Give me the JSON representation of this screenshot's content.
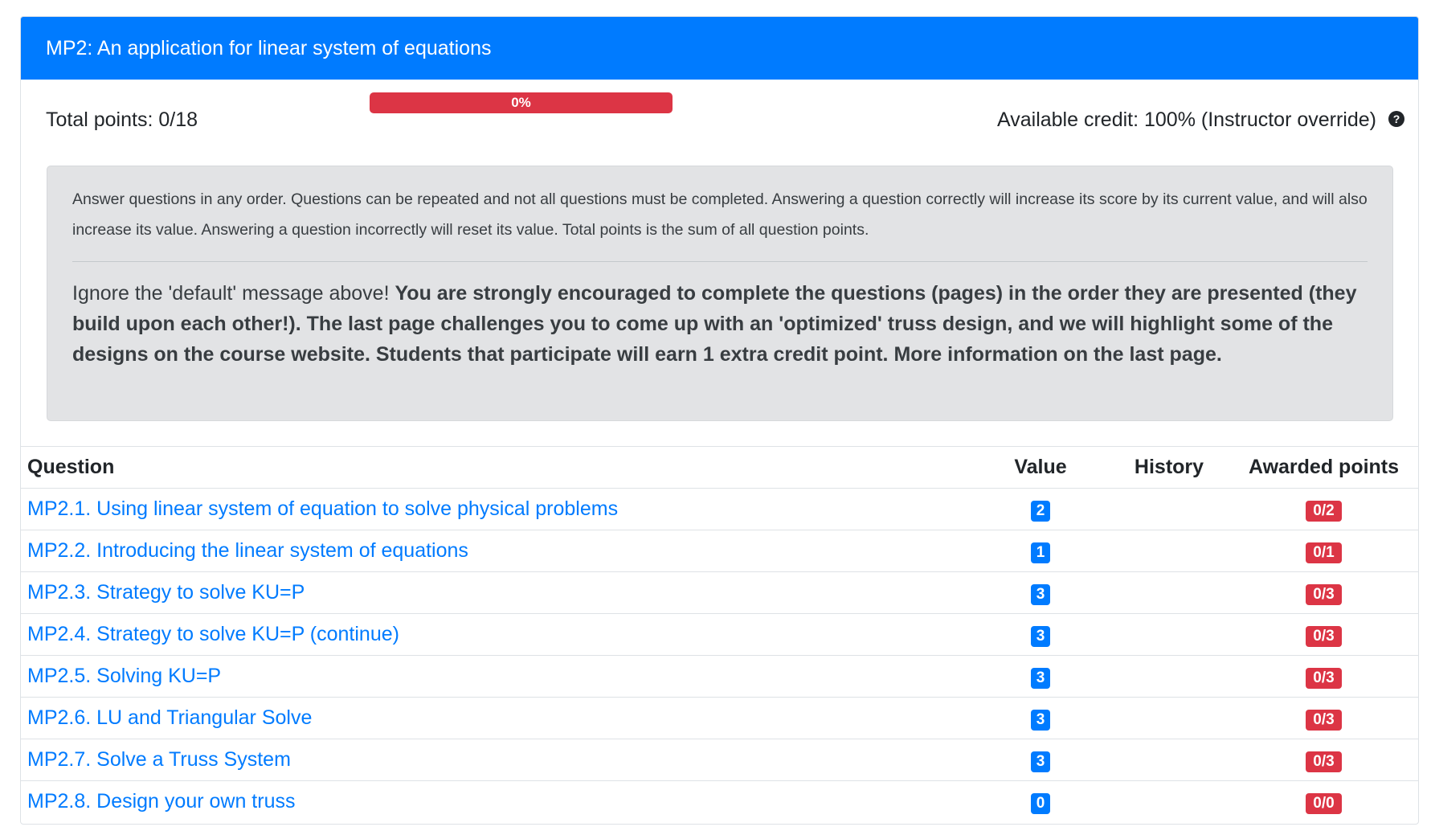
{
  "header": {
    "title": "MP2: An application for linear system of equations"
  },
  "points": {
    "total_label": "Total points: 0/18",
    "progress_percent": 0,
    "progress_label": "0%",
    "credit_label": "Available credit: 100% (Instructor override)",
    "help_icon": "question-circle-icon"
  },
  "alert": {
    "default_message": "Answer questions in any order. Questions can be repeated and not all questions must be completed. Answering a question correctly will increase its score by its current value, and will also increase its value. Answering a question incorrectly will reset its value. Total points is the sum of all question points.",
    "note_intro": "Ignore the 'default' message above! ",
    "note_bold": "You are strongly encouraged to complete the questions (pages) in the order they are presented (they build upon each other!). The last page challenges you to come up with an 'optimized' truss design, and we will highlight some of the designs on the course website. Students that participate will earn 1 extra credit point. More information on the last page."
  },
  "table": {
    "headers": {
      "question": "Question",
      "value": "Value",
      "history": "History",
      "awarded": "Awarded points"
    },
    "rows": [
      {
        "question": "MP2.1. Using linear system of equation to solve physical problems",
        "value": "2",
        "history": "",
        "awarded": "0/2"
      },
      {
        "question": "MP2.2. Introducing the linear system of equations",
        "value": "1",
        "history": "",
        "awarded": "0/1"
      },
      {
        "question": "MP2.3. Strategy to solve KU=P",
        "value": "3",
        "history": "",
        "awarded": "0/3"
      },
      {
        "question": "MP2.4. Strategy to solve KU=P (continue)",
        "value": "3",
        "history": "",
        "awarded": "0/3"
      },
      {
        "question": "MP2.5. Solving KU=P",
        "value": "3",
        "history": "",
        "awarded": "0/3"
      },
      {
        "question": "MP2.6. LU and Triangular Solve",
        "value": "3",
        "history": "",
        "awarded": "0/3"
      },
      {
        "question": "MP2.7. Solve a Truss System",
        "value": "3",
        "history": "",
        "awarded": "0/3"
      },
      {
        "question": "MP2.8. Design your own truss",
        "value": "0",
        "history": "",
        "awarded": "0/0"
      }
    ]
  },
  "colors": {
    "primary": "#007bff",
    "danger": "#dc3545",
    "alert_bg": "#e2e3e5"
  }
}
